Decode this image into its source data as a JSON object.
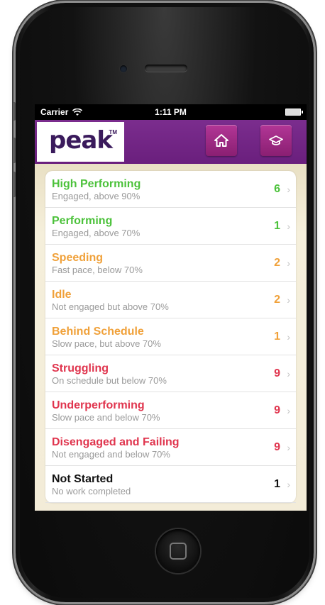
{
  "status_bar": {
    "carrier": "Carrier",
    "time": "1:11 PM"
  },
  "header": {
    "logo_text": "peak",
    "logo_tm": "TM",
    "home_icon": "home-icon",
    "grad_icon": "graduation-cap-icon"
  },
  "colors": {
    "nav_purple": "#6e2281",
    "green": "#4cc23b",
    "orange": "#f0a13a",
    "red": "#e0354e",
    "black": "#111111"
  },
  "list": [
    {
      "title": "High Performing",
      "subtitle": "Engaged, above 90%",
      "count": "6",
      "color": "#4cc23b"
    },
    {
      "title": "Performing",
      "subtitle": "Engaged, above 70%",
      "count": "1",
      "color": "#4cc23b"
    },
    {
      "title": "Speeding",
      "subtitle": "Fast pace, below 70%",
      "count": "2",
      "color": "#f0a13a"
    },
    {
      "title": "Idle",
      "subtitle": "Not engaged but above 70%",
      "count": "2",
      "color": "#f0a13a"
    },
    {
      "title": "Behind Schedule",
      "subtitle": "Slow pace, but above 70%",
      "count": "1",
      "color": "#f0a13a"
    },
    {
      "title": "Struggling",
      "subtitle": "On schedule but below 70%",
      "count": "9",
      "color": "#e0354e"
    },
    {
      "title": "Underperforming",
      "subtitle": "Slow pace and below 70%",
      "count": "9",
      "color": "#e0354e"
    },
    {
      "title": "Disengaged and Failing",
      "subtitle": "Not engaged and below 70%",
      "count": "9",
      "color": "#e0354e"
    },
    {
      "title": "Not Started",
      "subtitle": "No work completed",
      "count": "1",
      "color": "#111111"
    }
  ]
}
